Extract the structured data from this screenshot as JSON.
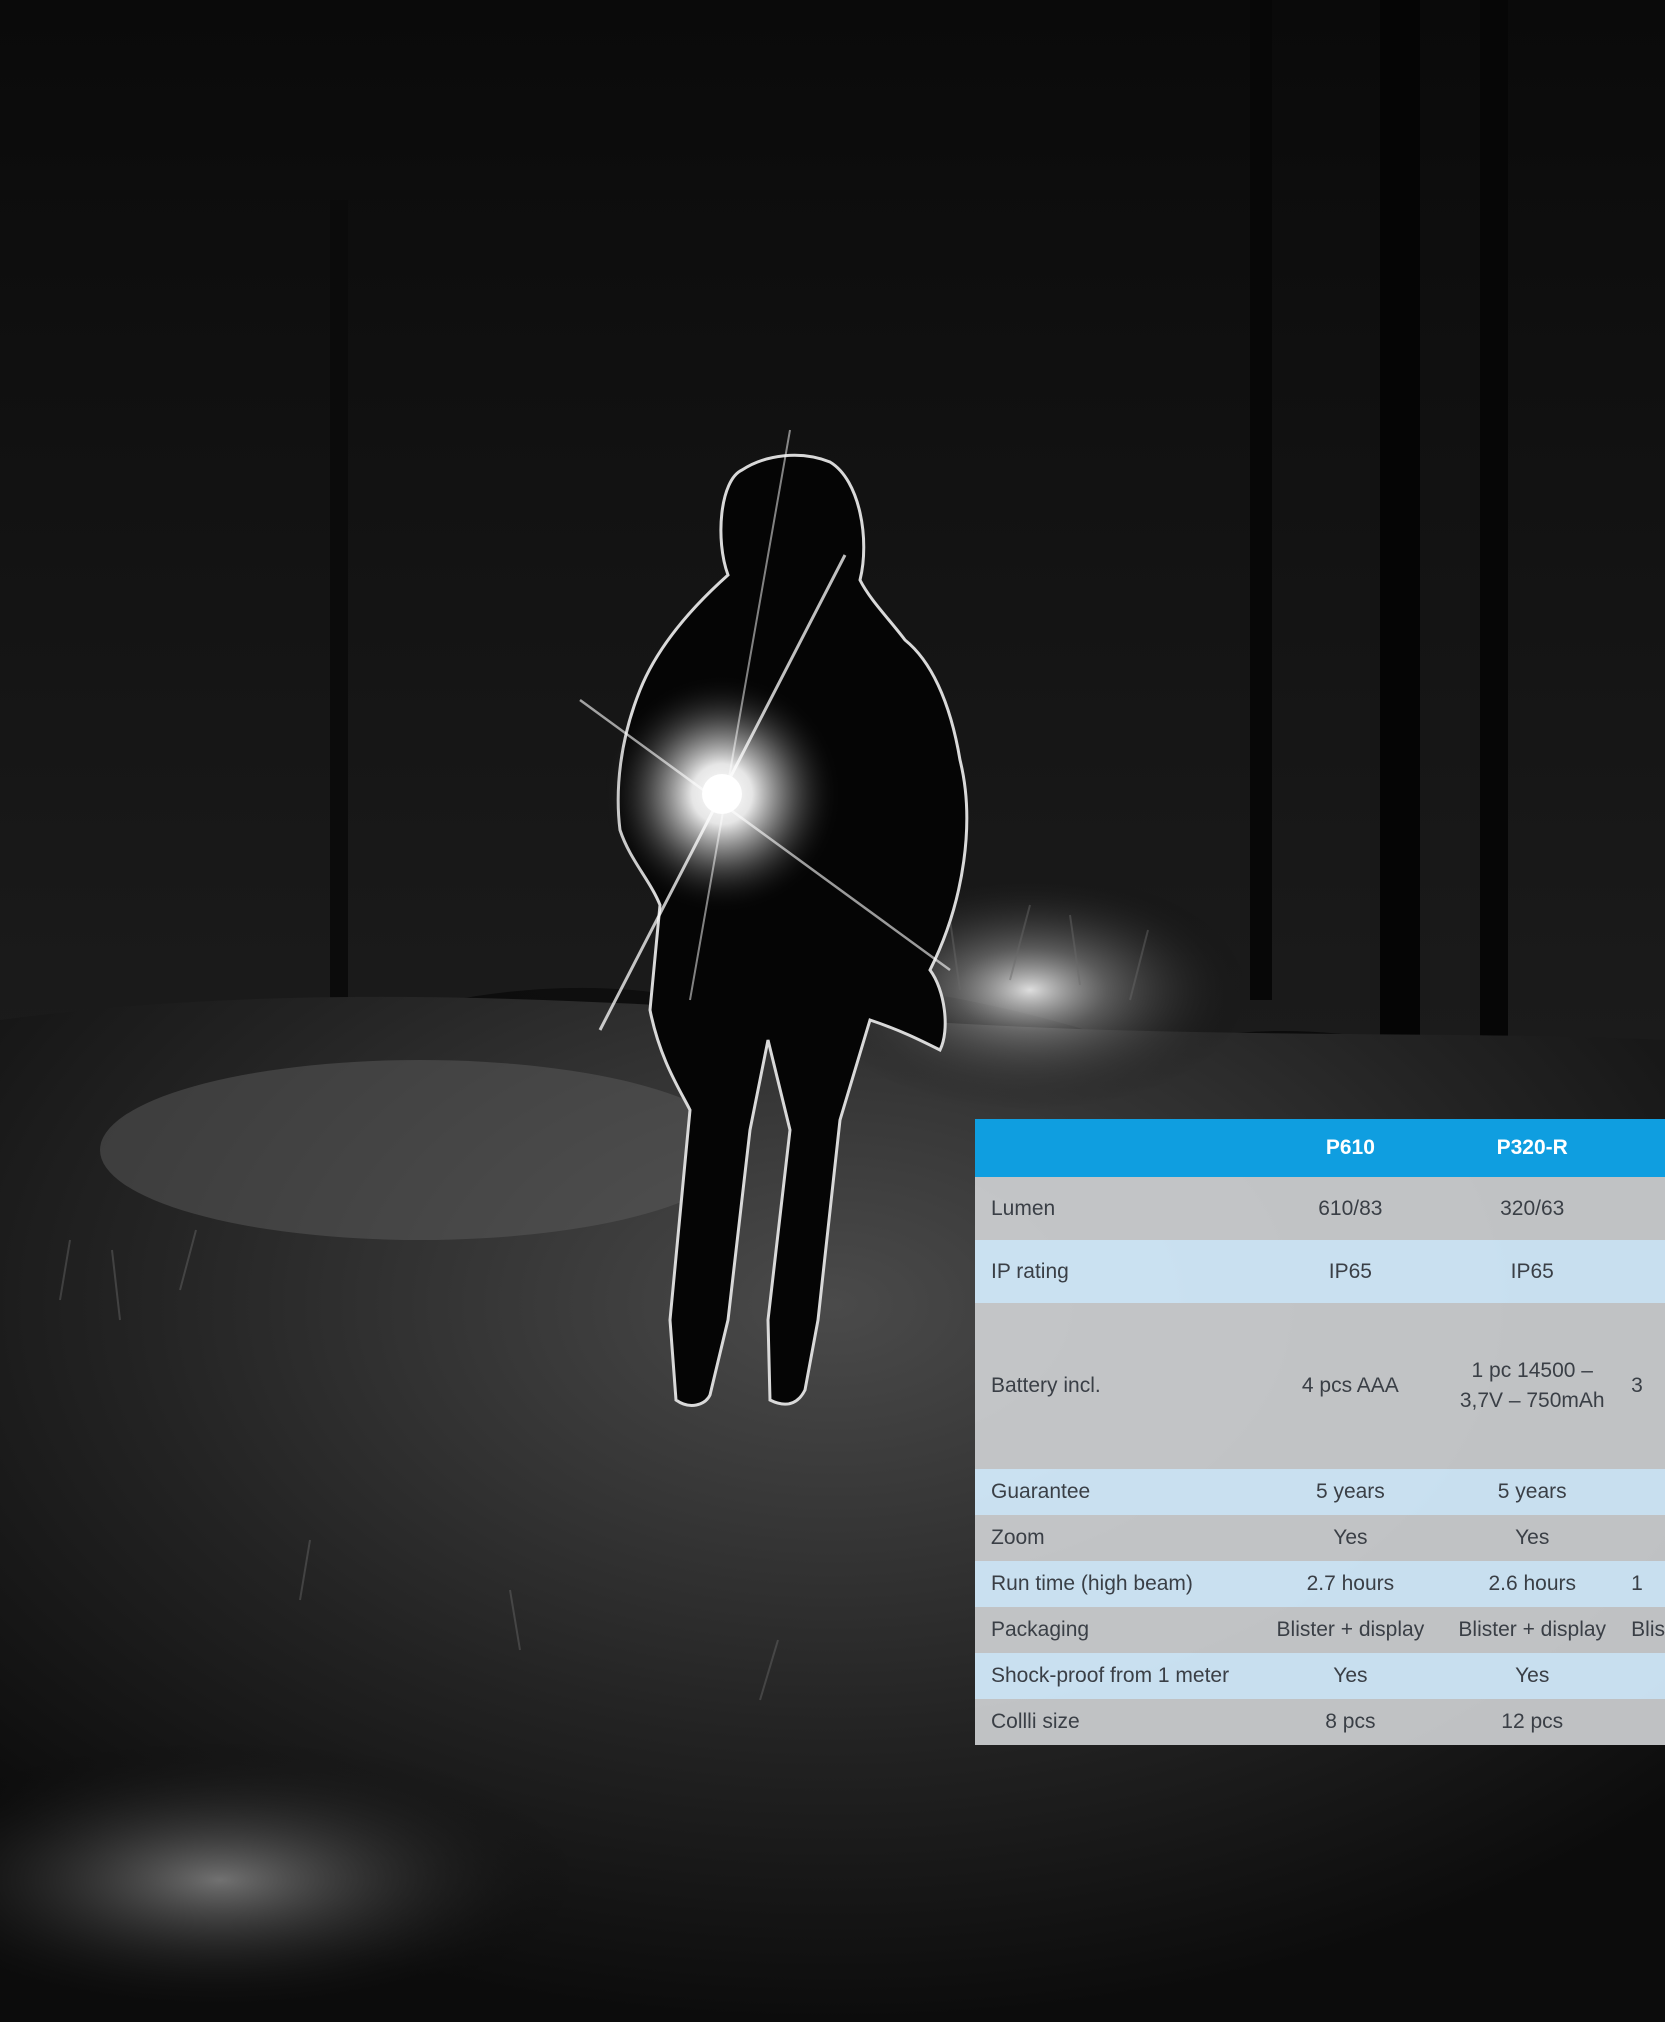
{
  "spec_table": {
    "headers": [
      "",
      "P610",
      "P320-R",
      ""
    ],
    "rows": [
      {
        "label": "Lumen",
        "values": [
          "610/83",
          "320/63",
          ""
        ]
      },
      {
        "label": "IP rating",
        "values": [
          "IP65",
          "IP65",
          ""
        ]
      },
      {
        "label": "Battery incl.",
        "values": [
          "4 pcs AAA",
          "1 pc 14500 – 3,7V – 750mAh",
          "3"
        ]
      },
      {
        "label": "Guarantee",
        "values": [
          "5 years",
          "5 years",
          ""
        ]
      },
      {
        "label": "Zoom",
        "values": [
          "Yes",
          "Yes",
          ""
        ]
      },
      {
        "label": "Run time (high beam)",
        "values": [
          "2.7 hours",
          "2.6 hours",
          "1"
        ]
      },
      {
        "label": "Packaging",
        "values": [
          "Blister + display",
          "Blister + display",
          "Blist"
        ]
      },
      {
        "label": "Shock-proof from 1 meter",
        "values": [
          "Yes",
          "Yes",
          ""
        ]
      },
      {
        "label": "Collli size",
        "values": [
          "8 pcs",
          "12 pcs",
          ""
        ]
      }
    ]
  },
  "colors": {
    "header_blue": "#0f9ee0",
    "row_gray": "#cfd0d3",
    "row_light_blue": "#d3eafb",
    "text": "#3a3f46"
  }
}
